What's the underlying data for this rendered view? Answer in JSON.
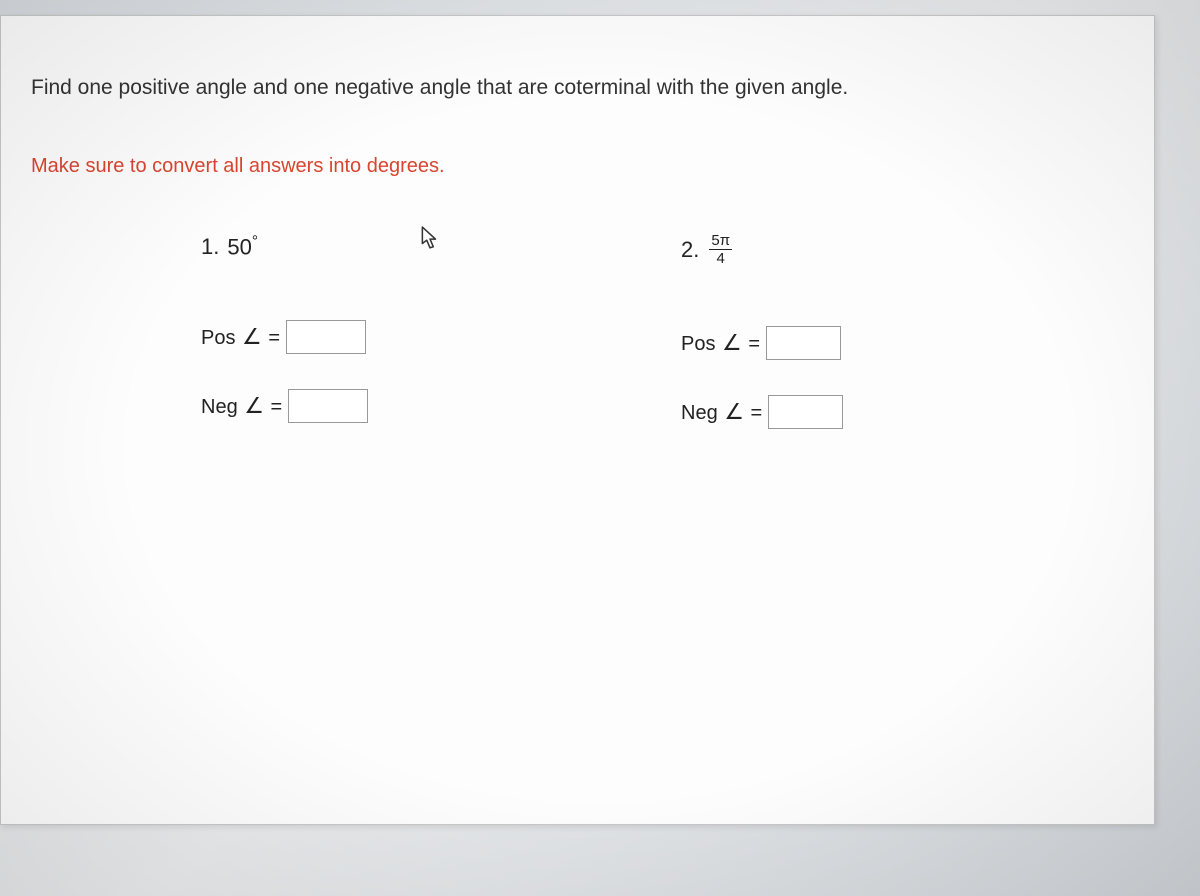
{
  "instruction": "Find one positive angle and one negative angle that are coterminal with the given angle.",
  "note": "Make sure to convert all answers into degrees.",
  "problems": [
    {
      "number": "1.",
      "angle_text": "50",
      "angle_unit": "°",
      "is_fraction": false,
      "pos_label": "Pos ",
      "neg_label": "Neg ",
      "equals": " =",
      "pos_value": "",
      "neg_value": ""
    },
    {
      "number": "2.",
      "fraction_num": "5π",
      "fraction_den": "4",
      "is_fraction": true,
      "pos_label": "Pos ",
      "neg_label": "Neg ",
      "equals": " =",
      "pos_value": "",
      "neg_value": ""
    }
  ],
  "angle_glyph": "∠"
}
